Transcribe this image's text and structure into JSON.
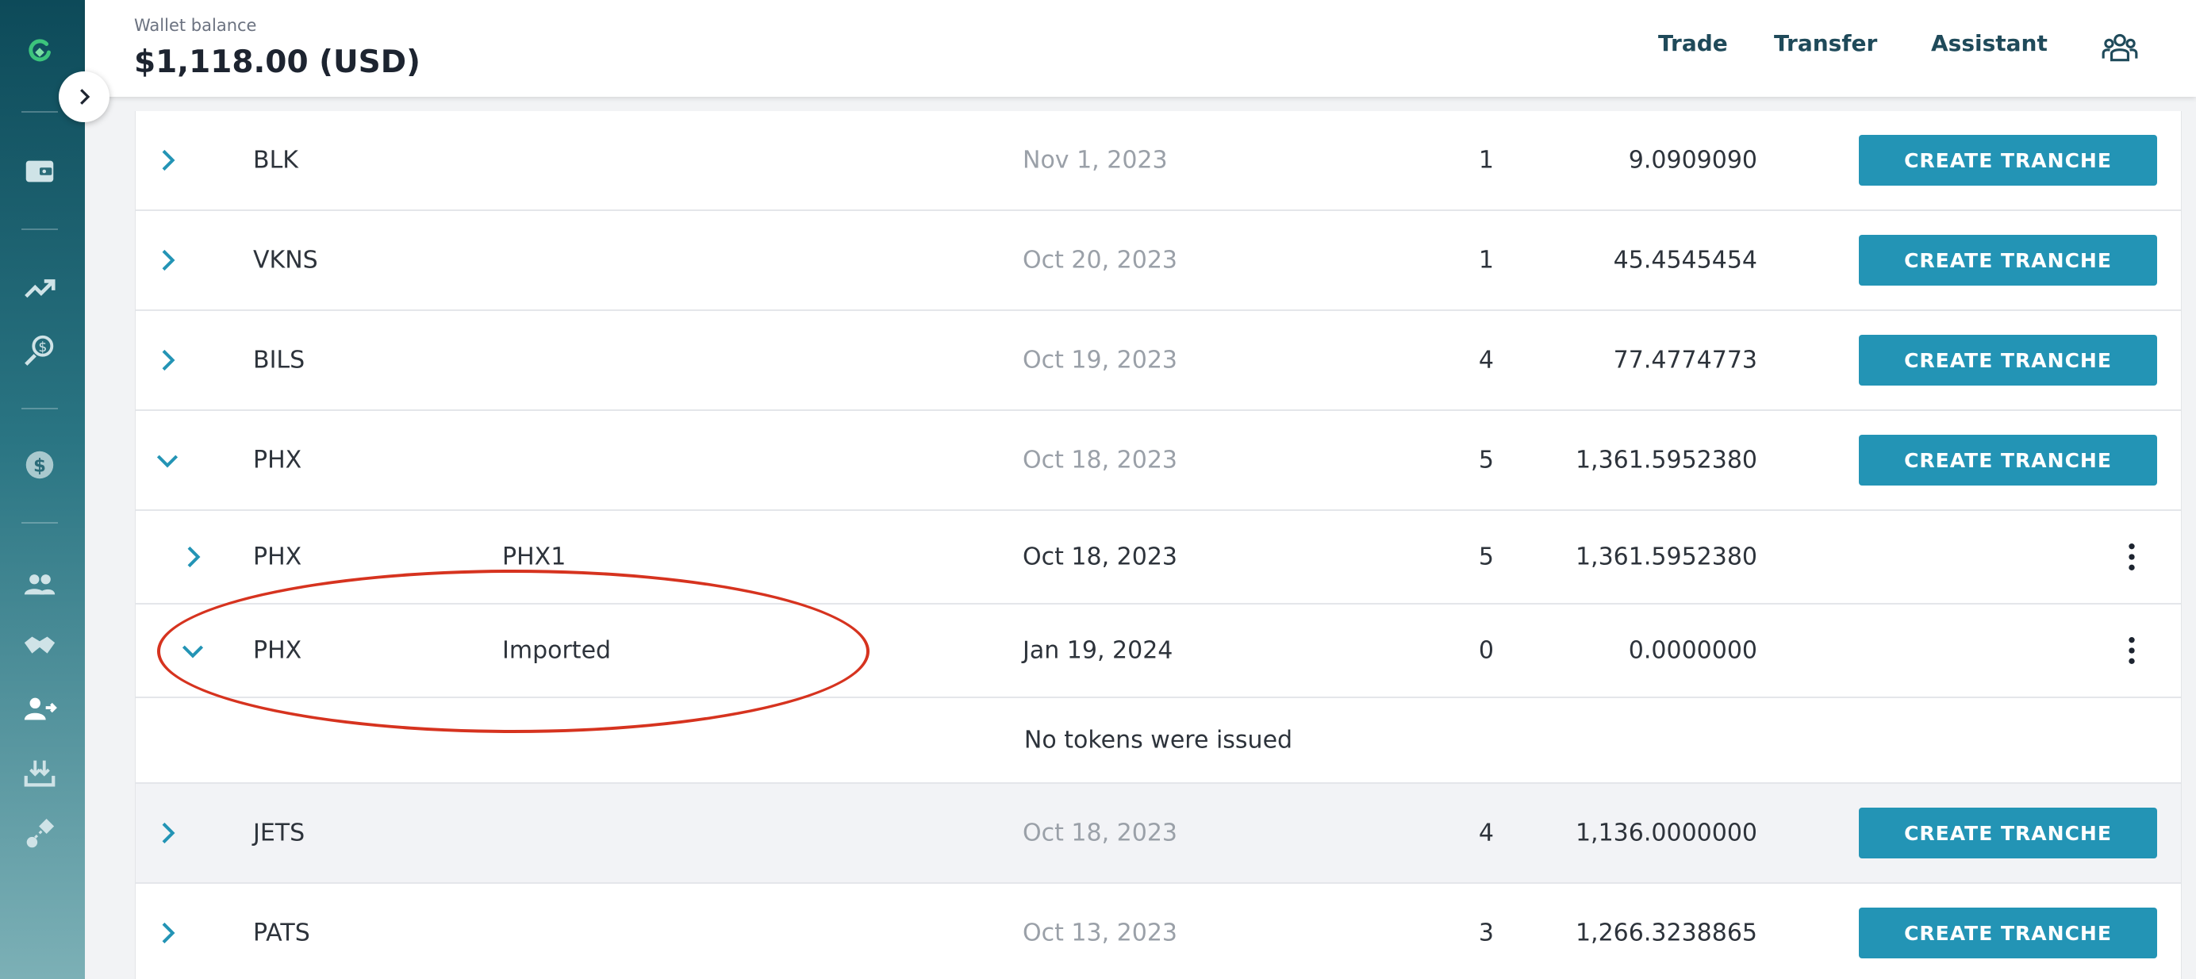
{
  "header": {
    "wallet_label": "Wallet balance",
    "wallet_value": "$1,118.00 (USD)",
    "nav": [
      "Trade",
      "Transfer",
      "Assistant"
    ]
  },
  "sidebar": {
    "icons": [
      "logo-icon",
      "wallet-icon",
      "trending-up-icon",
      "dollar-hand-icon",
      "dollar-circle-icon",
      "people-icon",
      "handshake-icon",
      "person-arrow-icon",
      "download-tray-icon",
      "shapes-icon"
    ]
  },
  "table": {
    "button_label": "CREATE TRANCHE",
    "rows": [
      {
        "symbol": "BLK",
        "date": "Nov 1, 2023",
        "count": "1",
        "amount": "9.0909090"
      },
      {
        "symbol": "VKNS",
        "date": "Oct 20, 2023",
        "count": "1",
        "amount": "45.4545454"
      },
      {
        "symbol": "BILS",
        "date": "Oct 19, 2023",
        "count": "4",
        "amount": "77.4774773"
      },
      {
        "symbol": "PHX",
        "date": "Oct 18, 2023",
        "count": "5",
        "amount": "1,361.5952380",
        "expanded": true
      },
      {
        "symbol": "JETS",
        "date": "Oct 18, 2023",
        "count": "4",
        "amount": "1,136.0000000"
      },
      {
        "symbol": "PATS",
        "date": "Oct 13, 2023",
        "count": "3",
        "amount": "1,266.3238865"
      }
    ],
    "sub_rows": [
      {
        "symbol": "PHX",
        "name": "PHX1",
        "date": "Oct 18, 2023",
        "count": "5",
        "amount": "1,361.5952380"
      },
      {
        "symbol": "PHX",
        "name": "Imported",
        "date": "Jan 19, 2024",
        "count": "0",
        "amount": "0.0000000",
        "expanded": true
      }
    ],
    "empty_message": "No tokens were issued"
  },
  "colors": {
    "accent": "#2394b5",
    "annotation": "#d6331f",
    "sidebar_top": "#0d4a59"
  }
}
